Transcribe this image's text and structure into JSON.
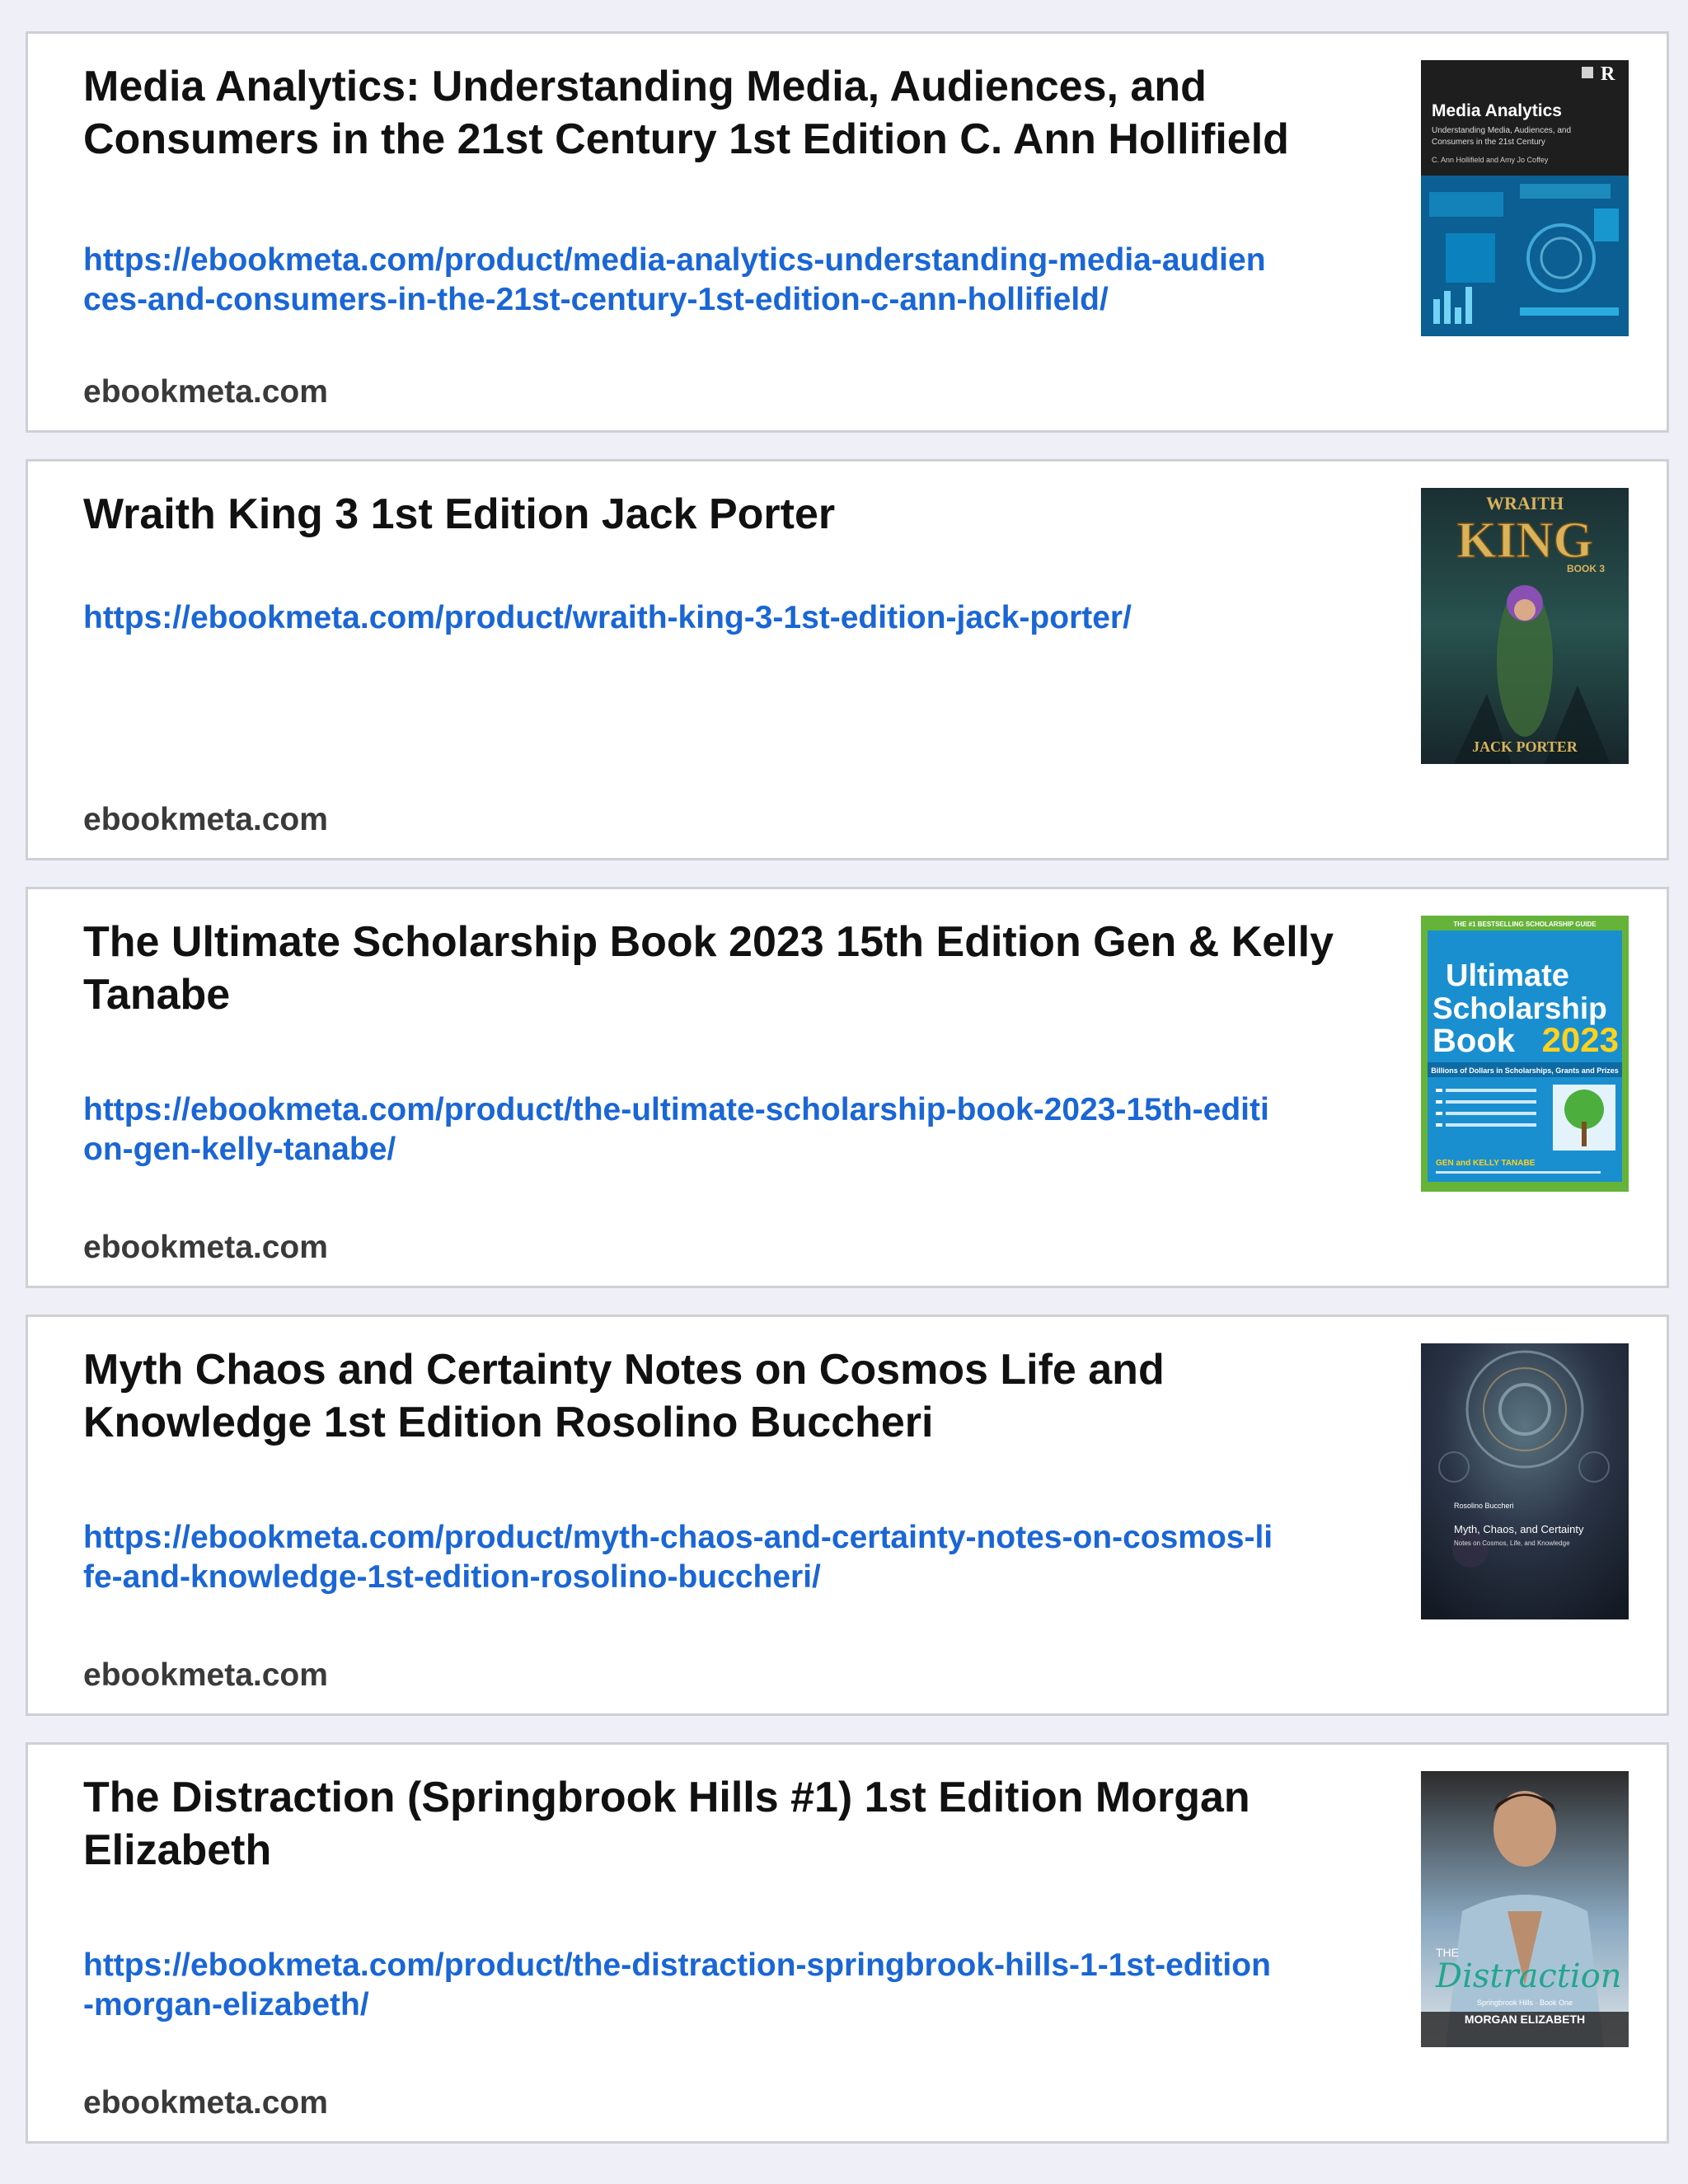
{
  "results": [
    {
      "title": "Media Analytics: Understanding Media, Audiences, and Consumers in the 21st Century 1st Edition C. Ann Hollifield",
      "url": "https://ebookmeta.com/product/media-analytics-understanding-media-audiences-and-consumers-in-the-21st-century-1st-edition-c-ann-hollifield/",
      "site": "ebookmeta.com",
      "cover": {
        "title": "Media Analytics",
        "subtitle_line1": "Understanding Media, Audiences, and",
        "subtitle_line2": "Consumers in the 21st Century",
        "authors": "C. Ann Hollifield and Amy Jo Coffey",
        "colors": {
          "top": "#1e1e1e",
          "art": "#0f6ea8"
        }
      }
    },
    {
      "title": "Wraith King 3 1st Edition Jack Porter",
      "url": "https://ebookmeta.com/product/wraith-king-3-1st-edition-jack-porter/",
      "site": "ebookmeta.com",
      "cover": {
        "title_top": "WRAITH",
        "title_main": "KING",
        "book": "BOOK 3",
        "author": "JACK PORTER",
        "colors": {
          "bg": "#1d3a3a",
          "gold": "#d9b25a"
        }
      }
    },
    {
      "title": "The Ultimate Scholarship Book 2023 15th Edition Gen & Kelly Tanabe",
      "url": "https://ebookmeta.com/product/the-ultimate-scholarship-book-2023-15th-edition-gen-kelly-tanabe/",
      "site": "ebookmeta.com",
      "cover": {
        "banner": "THE #1 BESTSELLING SCHOLARSHIP GUIDE",
        "line1": "Ultimate",
        "line2": "Scholarship",
        "line3": "Book",
        "year": "2023",
        "tagline": "Billions of Dollars in Scholarships, Grants and Prizes",
        "author": "GEN and KELLY TANABE",
        "colors": {
          "blue": "#1a8fd0",
          "green": "#66b33a",
          "yellow": "#ffd21f"
        }
      }
    },
    {
      "title": "Myth Chaos and Certainty Notes on Cosmos Life and Knowledge 1st Edition Rosolino Buccheri",
      "url": "https://ebookmeta.com/product/myth-chaos-and-certainty-notes-on-cosmos-life-and-knowledge-1st-edition-rosolino-buccheri/",
      "site": "ebookmeta.com",
      "cover": {
        "author": "Rosolino Buccheri",
        "title": "Myth, Chaos, and Certainty",
        "subtitle": "Notes on Cosmos, Life, and Knowledge",
        "colors": {
          "bg": "#1b2230"
        }
      }
    },
    {
      "title": "The Distraction (Springbrook Hills #1) 1st Edition Morgan Elizabeth",
      "url": "https://ebookmeta.com/product/the-distraction-springbrook-hills-1-1st-edition-morgan-elizabeth/",
      "site": "ebookmeta.com",
      "cover": {
        "the": "THE",
        "title": "Distraction",
        "series": "Springbrook Hills · Book One",
        "author": "MORGAN ELIZABETH",
        "colors": {
          "teal": "#22a68e"
        }
      }
    }
  ]
}
